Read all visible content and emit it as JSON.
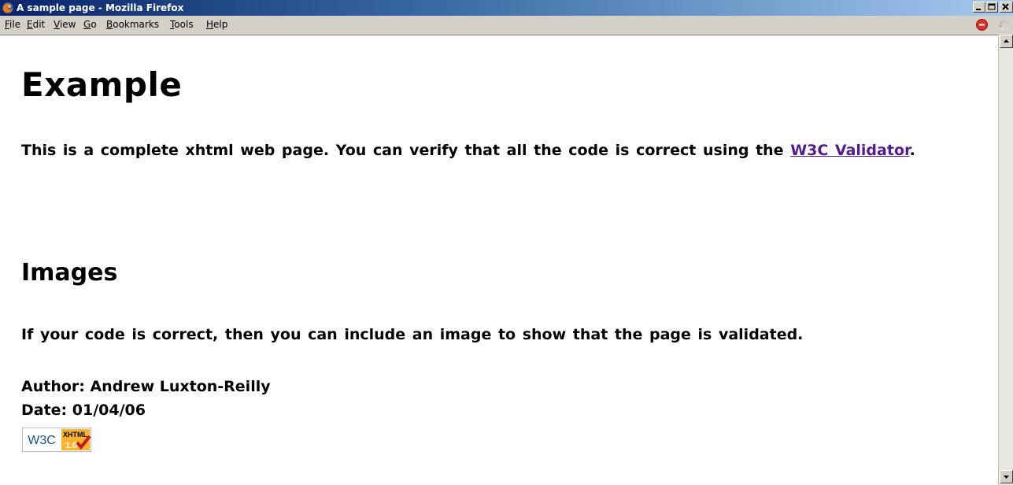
{
  "window": {
    "title": "A sample page - Mozilla Firefox"
  },
  "menubar": {
    "items": [
      {
        "accel": "F",
        "rest": "ile"
      },
      {
        "accel": "E",
        "rest": "dit"
      },
      {
        "accel": "V",
        "rest": "iew"
      },
      {
        "accel": "G",
        "rest": "o"
      },
      {
        "accel": "B",
        "rest": "ookmarks"
      },
      {
        "accel": "T",
        "rest": "ools"
      },
      {
        "accel": "H",
        "rest": "elp"
      }
    ]
  },
  "page": {
    "heading": "Example",
    "intro_text": "This is a complete xhtml web page. You can verify that all the code is correct using the ",
    "link_text": "W3C Validator",
    "intro_end": ".",
    "subheading": "Images",
    "images_text": "If your code is correct, then you can include an image to show that the page is validated.",
    "author_line": "Author: Andrew Luxton-Reilly",
    "date_line": "Date: 01/04/06"
  },
  "badge": {
    "w3c_text": "W3C",
    "xhtml_text": "XHTML",
    "version_text": "1.0"
  },
  "colors": {
    "titlebar_start": "#0a246a",
    "titlebar_end": "#a6caf0",
    "visited_link": "#551a8b",
    "chrome": "#d4d0c8"
  },
  "icons": {
    "app": "firefox-icon",
    "stop": "stop-icon",
    "throbber": "throbber-icon",
    "badge_check": "checkmark-icon"
  }
}
